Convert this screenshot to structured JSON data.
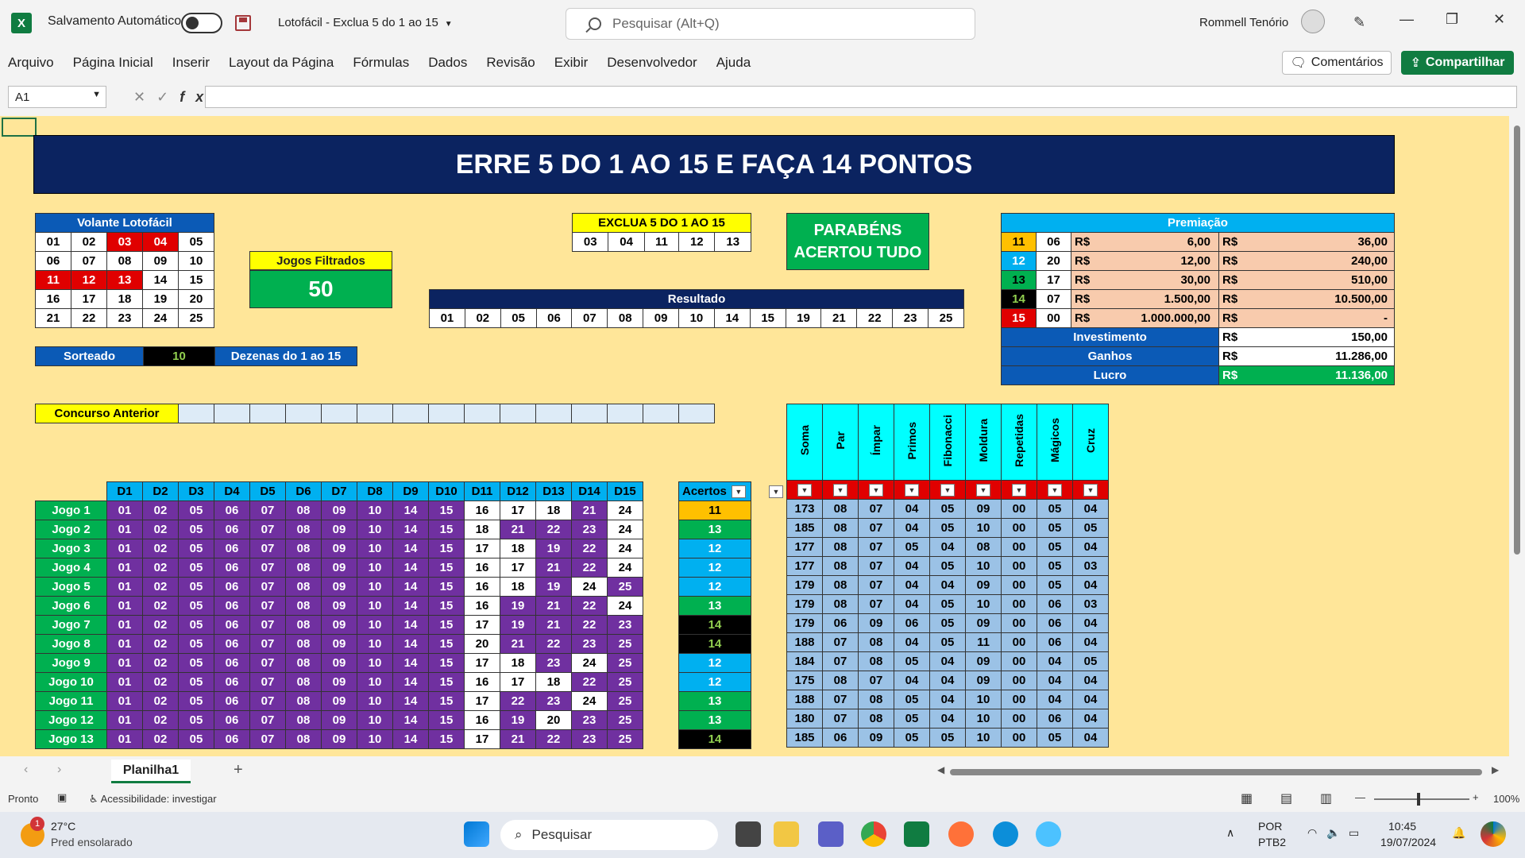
{
  "app": {
    "autosave_label": "Salvamento Automático",
    "doc_title": "Lotofácil - Exclua 5 do 1 ao 15",
    "search_placeholder": "Pesquisar (Alt+Q)",
    "user_name": "Rommell Tenório",
    "logo_letter": "X"
  },
  "menu": [
    "Arquivo",
    "Página Inicial",
    "Inserir",
    "Layout da Página",
    "Fórmulas",
    "Dados",
    "Revisão",
    "Exibir",
    "Desenvolvedor",
    "Ajuda"
  ],
  "buttons": {
    "comments": "Comentários",
    "share": "Compartilhar"
  },
  "namebox": "A1",
  "banner": "ERRE 5 DO 1 AO 15 E FAÇA 14 PONTOS",
  "volante": {
    "title": "Volante Lotofácil",
    "rows": [
      [
        [
          "01",
          "w"
        ],
        [
          "02",
          "w"
        ],
        [
          "03",
          "r"
        ],
        [
          "04",
          "r"
        ],
        [
          "05",
          "w"
        ]
      ],
      [
        [
          "06",
          "w"
        ],
        [
          "07",
          "w"
        ],
        [
          "08",
          "w"
        ],
        [
          "09",
          "w"
        ],
        [
          "10",
          "w"
        ]
      ],
      [
        [
          "11",
          "r"
        ],
        [
          "12",
          "r"
        ],
        [
          "13",
          "r"
        ],
        [
          "14",
          "w"
        ],
        [
          "15",
          "w"
        ]
      ],
      [
        [
          "16",
          "w"
        ],
        [
          "17",
          "w"
        ],
        [
          "18",
          "w"
        ],
        [
          "19",
          "w"
        ],
        [
          "20",
          "w"
        ]
      ],
      [
        [
          "21",
          "w"
        ],
        [
          "22",
          "w"
        ],
        [
          "23",
          "w"
        ],
        [
          "24",
          "w"
        ],
        [
          "25",
          "w"
        ]
      ]
    ]
  },
  "jogos_filtrados": {
    "label": "Jogos Filtrados",
    "value": "50"
  },
  "exclua": {
    "title": "EXCLUA 5 DO 1 AO 15",
    "numbers": [
      "03",
      "04",
      "11",
      "12",
      "13"
    ]
  },
  "parabens": {
    "line1": "PARABÉNS",
    "line2": "ACERTOU TUDO"
  },
  "resultado": {
    "title": "Resultado",
    "numbers": [
      "01",
      "02",
      "05",
      "06",
      "07",
      "08",
      "09",
      "10",
      "14",
      "15",
      "19",
      "21",
      "22",
      "23",
      "25"
    ]
  },
  "premiacao": {
    "title": "Premiação",
    "rows": [
      {
        "pts": "11",
        "cls": "c-orange",
        "qty": "06",
        "cur1": "R$",
        "val": "6,00",
        "cur2": "R$",
        "total": "36,00"
      },
      {
        "pts": "12",
        "cls": "c-cyan",
        "qty": "20",
        "cur1": "R$",
        "val": "12,00",
        "cur2": "R$",
        "total": "240,00"
      },
      {
        "pts": "13",
        "cls": "c-green",
        "qty": "17",
        "cur1": "R$",
        "val": "30,00",
        "cur2": "R$",
        "total": "510,00"
      },
      {
        "pts": "14",
        "cls": "c-blackgreen",
        "qty": "07",
        "cur1": "R$",
        "val": "1.500,00",
        "cur2": "R$",
        "total": "10.500,00"
      },
      {
        "pts": "15",
        "cls": "c-red",
        "qty": "00",
        "cur1": "R$",
        "val": "1.000.000,00",
        "cur2": "R$",
        "total": "-"
      }
    ],
    "investimento": {
      "label": "Investimento",
      "cur": "R$",
      "value": "150,00"
    },
    "ganhos": {
      "label": "Ganhos",
      "cur": "R$",
      "value": "11.286,00"
    },
    "lucro": {
      "label": "Lucro",
      "cur": "R$",
      "value": "11.136,00"
    }
  },
  "sorteado": {
    "label": "Sorteado",
    "value": "10",
    "dezenas": "Dezenas do 1 ao 15"
  },
  "concurso_anterior": "Concurso Anterior",
  "games": {
    "headers": [
      "D1",
      "D2",
      "D3",
      "D4",
      "D5",
      "D6",
      "D7",
      "D8",
      "D9",
      "D10",
      "D11",
      "D12",
      "D13",
      "D14",
      "D15"
    ],
    "acertos_label": "Acertos",
    "stat_headers": [
      "Soma",
      "Par",
      "Ímpar",
      "Primos",
      "Fibonacci",
      "Moldura",
      "Repetidas",
      "Mágicos",
      "Cruz"
    ],
    "rows": [
      {
        "name": "Jogo 1",
        "nums": [
          "01",
          "02",
          "05",
          "06",
          "07",
          "08",
          "09",
          "10",
          "14",
          "15",
          "16",
          "17",
          "18",
          "21",
          "24"
        ],
        "hit": [
          1,
          1,
          1,
          1,
          1,
          1,
          1,
          1,
          1,
          1,
          0,
          0,
          0,
          1,
          0
        ],
        "acertos": "11",
        "acls": "c-orange",
        "stats": [
          "173",
          "08",
          "07",
          "04",
          "05",
          "09",
          "00",
          "05",
          "04"
        ]
      },
      {
        "name": "Jogo 2",
        "nums": [
          "01",
          "02",
          "05",
          "06",
          "07",
          "08",
          "09",
          "10",
          "14",
          "15",
          "18",
          "21",
          "22",
          "23",
          "24"
        ],
        "hit": [
          1,
          1,
          1,
          1,
          1,
          1,
          1,
          1,
          1,
          1,
          0,
          1,
          1,
          1,
          0
        ],
        "acertos": "13",
        "acls": "c-darkgreen",
        "stats": [
          "185",
          "08",
          "07",
          "04",
          "05",
          "10",
          "00",
          "05",
          "05"
        ]
      },
      {
        "name": "Jogo 3",
        "nums": [
          "01",
          "02",
          "05",
          "06",
          "07",
          "08",
          "09",
          "10",
          "14",
          "15",
          "17",
          "18",
          "19",
          "22",
          "24"
        ],
        "hit": [
          1,
          1,
          1,
          1,
          1,
          1,
          1,
          1,
          1,
          1,
          0,
          0,
          1,
          1,
          0
        ],
        "acertos": "12",
        "acls": "c-cyan",
        "stats": [
          "177",
          "08",
          "07",
          "05",
          "04",
          "08",
          "00",
          "05",
          "04"
        ]
      },
      {
        "name": "Jogo 4",
        "nums": [
          "01",
          "02",
          "05",
          "06",
          "07",
          "08",
          "09",
          "10",
          "14",
          "15",
          "16",
          "17",
          "21",
          "22",
          "24"
        ],
        "hit": [
          1,
          1,
          1,
          1,
          1,
          1,
          1,
          1,
          1,
          1,
          0,
          0,
          1,
          1,
          0
        ],
        "acertos": "12",
        "acls": "c-cyan",
        "stats": [
          "177",
          "08",
          "07",
          "04",
          "05",
          "10",
          "00",
          "05",
          "03"
        ]
      },
      {
        "name": "Jogo 5",
        "nums": [
          "01",
          "02",
          "05",
          "06",
          "07",
          "08",
          "09",
          "10",
          "14",
          "15",
          "16",
          "18",
          "19",
          "24",
          "25"
        ],
        "hit": [
          1,
          1,
          1,
          1,
          1,
          1,
          1,
          1,
          1,
          1,
          0,
          0,
          1,
          0,
          1
        ],
        "acertos": "12",
        "acls": "c-cyan",
        "stats": [
          "179",
          "08",
          "07",
          "04",
          "04",
          "09",
          "00",
          "05",
          "04"
        ]
      },
      {
        "name": "Jogo 6",
        "nums": [
          "01",
          "02",
          "05",
          "06",
          "07",
          "08",
          "09",
          "10",
          "14",
          "15",
          "16",
          "19",
          "21",
          "22",
          "24"
        ],
        "hit": [
          1,
          1,
          1,
          1,
          1,
          1,
          1,
          1,
          1,
          1,
          0,
          1,
          1,
          1,
          0
        ],
        "acertos": "13",
        "acls": "c-darkgreen",
        "stats": [
          "179",
          "08",
          "07",
          "04",
          "05",
          "10",
          "00",
          "06",
          "03"
        ]
      },
      {
        "name": "Jogo 7",
        "nums": [
          "01",
          "02",
          "05",
          "06",
          "07",
          "08",
          "09",
          "10",
          "14",
          "15",
          "17",
          "19",
          "21",
          "22",
          "23"
        ],
        "hit": [
          1,
          1,
          1,
          1,
          1,
          1,
          1,
          1,
          1,
          1,
          0,
          1,
          1,
          1,
          1
        ],
        "acertos": "14",
        "acls": "c-blackgreen",
        "stats": [
          "179",
          "06",
          "09",
          "06",
          "05",
          "09",
          "00",
          "06",
          "04"
        ]
      },
      {
        "name": "Jogo 8",
        "nums": [
          "01",
          "02",
          "05",
          "06",
          "07",
          "08",
          "09",
          "10",
          "14",
          "15",
          "20",
          "21",
          "22",
          "23",
          "25"
        ],
        "hit": [
          1,
          1,
          1,
          1,
          1,
          1,
          1,
          1,
          1,
          1,
          0,
          1,
          1,
          1,
          1
        ],
        "acertos": "14",
        "acls": "c-blackgreen",
        "stats": [
          "188",
          "07",
          "08",
          "04",
          "05",
          "11",
          "00",
          "06",
          "04"
        ]
      },
      {
        "name": "Jogo 9",
        "nums": [
          "01",
          "02",
          "05",
          "06",
          "07",
          "08",
          "09",
          "10",
          "14",
          "15",
          "17",
          "18",
          "23",
          "24",
          "25"
        ],
        "hit": [
          1,
          1,
          1,
          1,
          1,
          1,
          1,
          1,
          1,
          1,
          0,
          0,
          1,
          0,
          1
        ],
        "acertos": "12",
        "acls": "c-cyan",
        "stats": [
          "184",
          "07",
          "08",
          "05",
          "04",
          "09",
          "00",
          "04",
          "05"
        ]
      },
      {
        "name": "Jogo 10",
        "nums": [
          "01",
          "02",
          "05",
          "06",
          "07",
          "08",
          "09",
          "10",
          "14",
          "15",
          "16",
          "17",
          "18",
          "22",
          "25"
        ],
        "hit": [
          1,
          1,
          1,
          1,
          1,
          1,
          1,
          1,
          1,
          1,
          0,
          0,
          0,
          1,
          1
        ],
        "acertos": "12",
        "acls": "c-cyan",
        "stats": [
          "175",
          "08",
          "07",
          "04",
          "04",
          "09",
          "00",
          "04",
          "04"
        ]
      },
      {
        "name": "Jogo 11",
        "nums": [
          "01",
          "02",
          "05",
          "06",
          "07",
          "08",
          "09",
          "10",
          "14",
          "15",
          "17",
          "22",
          "23",
          "24",
          "25"
        ],
        "hit": [
          1,
          1,
          1,
          1,
          1,
          1,
          1,
          1,
          1,
          1,
          0,
          1,
          1,
          0,
          1
        ],
        "acertos": "13",
        "acls": "c-darkgreen",
        "stats": [
          "188",
          "07",
          "08",
          "05",
          "04",
          "10",
          "00",
          "04",
          "04"
        ]
      },
      {
        "name": "Jogo 12",
        "nums": [
          "01",
          "02",
          "05",
          "06",
          "07",
          "08",
          "09",
          "10",
          "14",
          "15",
          "16",
          "19",
          "20",
          "23",
          "25"
        ],
        "hit": [
          1,
          1,
          1,
          1,
          1,
          1,
          1,
          1,
          1,
          1,
          0,
          1,
          0,
          1,
          1
        ],
        "acertos": "13",
        "acls": "c-darkgreen",
        "stats": [
          "180",
          "07",
          "08",
          "05",
          "04",
          "10",
          "00",
          "06",
          "04"
        ]
      },
      {
        "name": "Jogo 13",
        "nums": [
          "01",
          "02",
          "05",
          "06",
          "07",
          "08",
          "09",
          "10",
          "14",
          "15",
          "17",
          "21",
          "22",
          "23",
          "25"
        ],
        "hit": [
          1,
          1,
          1,
          1,
          1,
          1,
          1,
          1,
          1,
          1,
          0,
          1,
          1,
          1,
          1
        ],
        "acertos": "14",
        "acls": "c-blackgreen",
        "stats": [
          "185",
          "06",
          "09",
          "05",
          "05",
          "10",
          "00",
          "05",
          "04"
        ]
      }
    ]
  },
  "sheet_tab": "Planilha1",
  "status": {
    "ready": "Pronto",
    "accessibility": "Acessibilidade: investigar",
    "zoom": "100%"
  },
  "taskbar": {
    "weather_temp": "27°C",
    "weather_desc": "Pred ensolarado",
    "badge": "1",
    "search": "Pesquisar",
    "lang1": "POR",
    "lang2": "PTB2",
    "time": "10:45",
    "date": "19/07/2024"
  }
}
